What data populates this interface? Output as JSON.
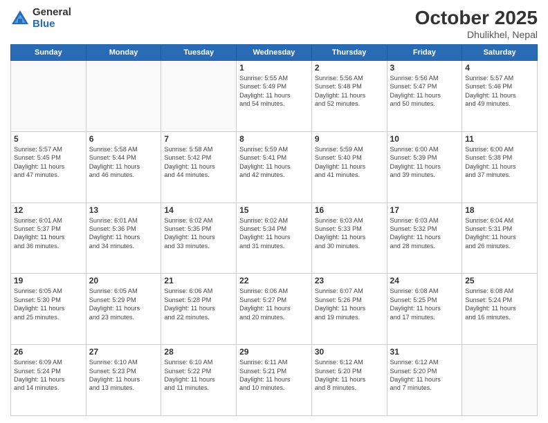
{
  "header": {
    "logo_general": "General",
    "logo_blue": "Blue",
    "month_title": "October 2025",
    "location": "Dhulikhel, Nepal"
  },
  "weekdays": [
    "Sunday",
    "Monday",
    "Tuesday",
    "Wednesday",
    "Thursday",
    "Friday",
    "Saturday"
  ],
  "weeks": [
    [
      {
        "day": "",
        "info": ""
      },
      {
        "day": "",
        "info": ""
      },
      {
        "day": "",
        "info": ""
      },
      {
        "day": "1",
        "info": "Sunrise: 5:55 AM\nSunset: 5:49 PM\nDaylight: 11 hours\nand 54 minutes."
      },
      {
        "day": "2",
        "info": "Sunrise: 5:56 AM\nSunset: 5:48 PM\nDaylight: 11 hours\nand 52 minutes."
      },
      {
        "day": "3",
        "info": "Sunrise: 5:56 AM\nSunset: 5:47 PM\nDaylight: 11 hours\nand 50 minutes."
      },
      {
        "day": "4",
        "info": "Sunrise: 5:57 AM\nSunset: 5:46 PM\nDaylight: 11 hours\nand 49 minutes."
      }
    ],
    [
      {
        "day": "5",
        "info": "Sunrise: 5:57 AM\nSunset: 5:45 PM\nDaylight: 11 hours\nand 47 minutes."
      },
      {
        "day": "6",
        "info": "Sunrise: 5:58 AM\nSunset: 5:44 PM\nDaylight: 11 hours\nand 46 minutes."
      },
      {
        "day": "7",
        "info": "Sunrise: 5:58 AM\nSunset: 5:42 PM\nDaylight: 11 hours\nand 44 minutes."
      },
      {
        "day": "8",
        "info": "Sunrise: 5:59 AM\nSunset: 5:41 PM\nDaylight: 11 hours\nand 42 minutes."
      },
      {
        "day": "9",
        "info": "Sunrise: 5:59 AM\nSunset: 5:40 PM\nDaylight: 11 hours\nand 41 minutes."
      },
      {
        "day": "10",
        "info": "Sunrise: 6:00 AM\nSunset: 5:39 PM\nDaylight: 11 hours\nand 39 minutes."
      },
      {
        "day": "11",
        "info": "Sunrise: 6:00 AM\nSunset: 5:38 PM\nDaylight: 11 hours\nand 37 minutes."
      }
    ],
    [
      {
        "day": "12",
        "info": "Sunrise: 6:01 AM\nSunset: 5:37 PM\nDaylight: 11 hours\nand 36 minutes."
      },
      {
        "day": "13",
        "info": "Sunrise: 6:01 AM\nSunset: 5:36 PM\nDaylight: 11 hours\nand 34 minutes."
      },
      {
        "day": "14",
        "info": "Sunrise: 6:02 AM\nSunset: 5:35 PM\nDaylight: 11 hours\nand 33 minutes."
      },
      {
        "day": "15",
        "info": "Sunrise: 6:02 AM\nSunset: 5:34 PM\nDaylight: 11 hours\nand 31 minutes."
      },
      {
        "day": "16",
        "info": "Sunrise: 6:03 AM\nSunset: 5:33 PM\nDaylight: 11 hours\nand 30 minutes."
      },
      {
        "day": "17",
        "info": "Sunrise: 6:03 AM\nSunset: 5:32 PM\nDaylight: 11 hours\nand 28 minutes."
      },
      {
        "day": "18",
        "info": "Sunrise: 6:04 AM\nSunset: 5:31 PM\nDaylight: 11 hours\nand 26 minutes."
      }
    ],
    [
      {
        "day": "19",
        "info": "Sunrise: 6:05 AM\nSunset: 5:30 PM\nDaylight: 11 hours\nand 25 minutes."
      },
      {
        "day": "20",
        "info": "Sunrise: 6:05 AM\nSunset: 5:29 PM\nDaylight: 11 hours\nand 23 minutes."
      },
      {
        "day": "21",
        "info": "Sunrise: 6:06 AM\nSunset: 5:28 PM\nDaylight: 11 hours\nand 22 minutes."
      },
      {
        "day": "22",
        "info": "Sunrise: 6:06 AM\nSunset: 5:27 PM\nDaylight: 11 hours\nand 20 minutes."
      },
      {
        "day": "23",
        "info": "Sunrise: 6:07 AM\nSunset: 5:26 PM\nDaylight: 11 hours\nand 19 minutes."
      },
      {
        "day": "24",
        "info": "Sunrise: 6:08 AM\nSunset: 5:25 PM\nDaylight: 11 hours\nand 17 minutes."
      },
      {
        "day": "25",
        "info": "Sunrise: 6:08 AM\nSunset: 5:24 PM\nDaylight: 11 hours\nand 16 minutes."
      }
    ],
    [
      {
        "day": "26",
        "info": "Sunrise: 6:09 AM\nSunset: 5:24 PM\nDaylight: 11 hours\nand 14 minutes."
      },
      {
        "day": "27",
        "info": "Sunrise: 6:10 AM\nSunset: 5:23 PM\nDaylight: 11 hours\nand 13 minutes."
      },
      {
        "day": "28",
        "info": "Sunrise: 6:10 AM\nSunset: 5:22 PM\nDaylight: 11 hours\nand 11 minutes."
      },
      {
        "day": "29",
        "info": "Sunrise: 6:11 AM\nSunset: 5:21 PM\nDaylight: 11 hours\nand 10 minutes."
      },
      {
        "day": "30",
        "info": "Sunrise: 6:12 AM\nSunset: 5:20 PM\nDaylight: 11 hours\nand 8 minutes."
      },
      {
        "day": "31",
        "info": "Sunrise: 6:12 AM\nSunset: 5:20 PM\nDaylight: 11 hours\nand 7 minutes."
      },
      {
        "day": "",
        "info": ""
      }
    ]
  ]
}
